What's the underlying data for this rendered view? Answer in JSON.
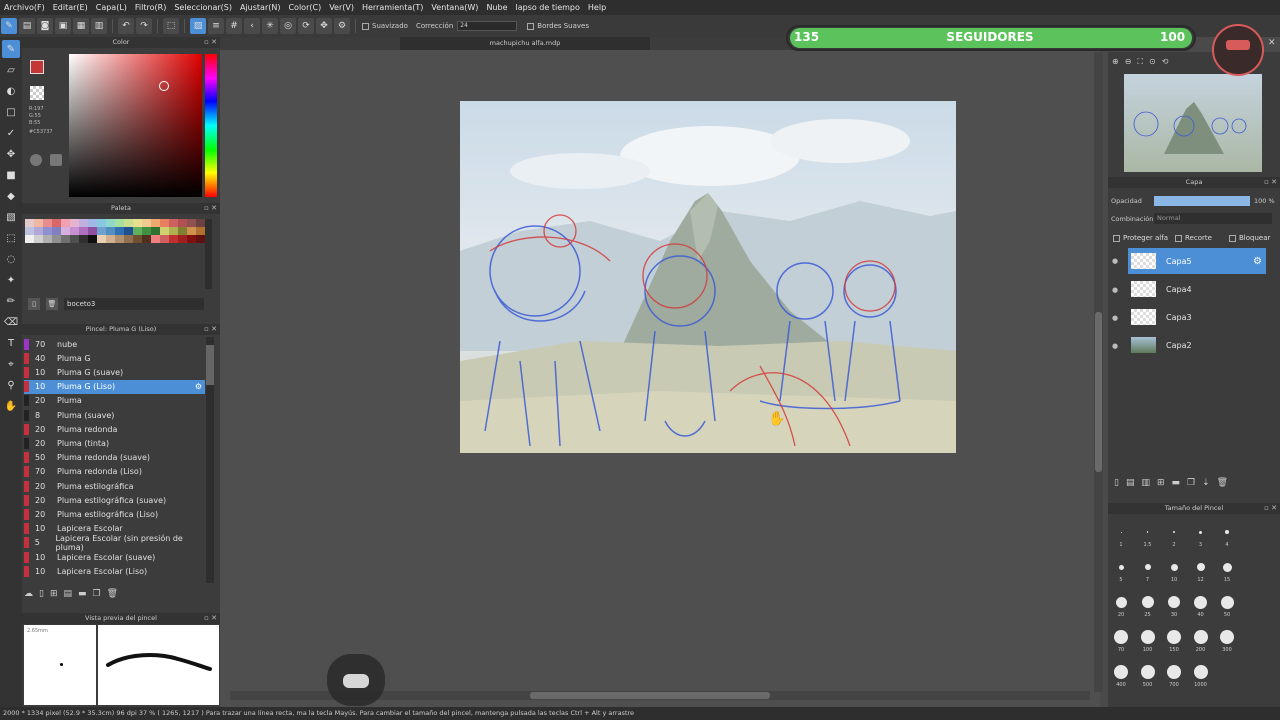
{
  "menu": [
    "Archivo(F)",
    "Editar(E)",
    "Capa(L)",
    "Filtro(R)",
    "Seleccionar(S)",
    "Ajustar(N)",
    "Color(C)",
    "Ver(V)",
    "Herramienta(T)",
    "Ventana(W)",
    "Nube",
    "lapso de tiempo",
    "Help"
  ],
  "toolbar": {
    "suavizado_label": "Suavizado",
    "correccion_label": "Corrección",
    "correccion_value": "24",
    "bordes_label": "Bordes Suaves"
  },
  "document": {
    "filename": "machupichu alfa.mdp"
  },
  "color_panel": {
    "title": "Color",
    "rgb": [
      "R:197",
      "G:55",
      "B:55"
    ],
    "hex": "#C53737",
    "fg": "#c53737"
  },
  "palette_panel": {
    "title": "Paleta",
    "preset_name": "boceto3"
  },
  "palette_colors": [
    "#e3c9c9",
    "#f0b7a0",
    "#e98c8c",
    "#d86767",
    "#f0a0b0",
    "#e6b3d0",
    "#c0b0e0",
    "#a0b8e8",
    "#88c8e0",
    "#90d8c8",
    "#a8e0a0",
    "#c8e090",
    "#e8e090",
    "#f0c890",
    "#f0a870",
    "#e88060",
    "#d06060",
    "#b05050",
    "#905050",
    "#6a4040",
    "#c0c0e0",
    "#b0a8d8",
    "#9090d0",
    "#8080c0",
    "#d8b0e0",
    "#c890d0",
    "#b070c0",
    "#9050a0",
    "#70a0d0",
    "#5090c0",
    "#3070b0",
    "#205090",
    "#60b060",
    "#409040",
    "#307030",
    "#d0d070",
    "#b0b050",
    "#808030",
    "#d09050",
    "#b07030",
    "#f0f0f0",
    "#d0d0d0",
    "#b0b0b0",
    "#909090",
    "#707070",
    "#505050",
    "#303030",
    "#101010",
    "#e8d0b0",
    "#d0b090",
    "#b09070",
    "#907050",
    "#705030",
    "#503020",
    "#f08080",
    "#d06060",
    "#c03030",
    "#a02020",
    "#801010",
    "#601010"
  ],
  "brush_panel": {
    "title": "Pincel: Pluma G (Liso)",
    "items": [
      {
        "size": "70",
        "name": "nube",
        "color": "#9b35c6"
      },
      {
        "size": "40",
        "name": "Pluma G",
        "color": "#c62f3d"
      },
      {
        "size": "10",
        "name": "Pluma G (suave)",
        "color": "#c62f3d"
      },
      {
        "size": "10",
        "name": "Pluma G (Liso)",
        "color": "#c62f3d"
      },
      {
        "size": "20",
        "name": "Pluma",
        "color": "#222222"
      },
      {
        "size": "8",
        "name": "Pluma (suave)",
        "color": "#222222"
      },
      {
        "size": "20",
        "name": "Pluma redonda",
        "color": "#c62f3d"
      },
      {
        "size": "20",
        "name": "Pluma (tinta)",
        "color": "#222222"
      },
      {
        "size": "50",
        "name": "Pluma redonda (suave)",
        "color": "#c62f3d"
      },
      {
        "size": "70",
        "name": "Pluma redonda (Liso)",
        "color": "#c62f3d"
      },
      {
        "size": "20",
        "name": "Pluma estilográfica",
        "color": "#c62f3d"
      },
      {
        "size": "20",
        "name": "Pluma estilográfica (suave)",
        "color": "#c62f3d"
      },
      {
        "size": "20",
        "name": "Pluma estilográfica (Liso)",
        "color": "#c62f3d"
      },
      {
        "size": "10",
        "name": "Lapicera Escolar",
        "color": "#c62f3d"
      },
      {
        "size": "5",
        "name": "Lapicera Escolar (sin presión de pluma)",
        "color": "#c62f3d"
      },
      {
        "size": "10",
        "name": "Lapicera Escolar (suave)",
        "color": "#c62f3d"
      },
      {
        "size": "10",
        "name": "Lapicera Escolar (Liso)",
        "color": "#c62f3d"
      }
    ]
  },
  "preview_panel": {
    "title": "Vista previa del pincel",
    "size": "2.65mm"
  },
  "layer_panel": {
    "title": "Capa",
    "opacity_label": "Opacidad",
    "opacity_value": "100 %",
    "blend_label": "Combinación",
    "blend_value": "Normal",
    "protect_alpha": "Proteger alfa",
    "clipping": "Recorte",
    "lock": "Bloquear",
    "layers": [
      "Capa5",
      "Capa4",
      "Capa3",
      "Capa2"
    ]
  },
  "brush_size_panel": {
    "title": "Tamaño del Pincel",
    "sizes": [
      "1",
      "1.5",
      "2",
      "3",
      "4",
      "5",
      "7",
      "10",
      "12",
      "15",
      "20",
      "25",
      "30",
      "40",
      "50",
      "70",
      "100",
      "150",
      "200",
      "300",
      "400",
      "500",
      "700",
      "1000"
    ]
  },
  "followers_overlay": {
    "left": "135",
    "label": "SEGUIDORES",
    "right": "100"
  },
  "status": {
    "text": "2000 * 1334 pixel  (52.9 * 35.3cm)  96 dpi  37 %  ( 1265, 1217 )  Para trazar una línea recta, ma                  la tecla Mayús. Para cambiar el tamaño del pincel, mantenga pulsada las teclas Ctrl + Alt y arrastre"
  }
}
